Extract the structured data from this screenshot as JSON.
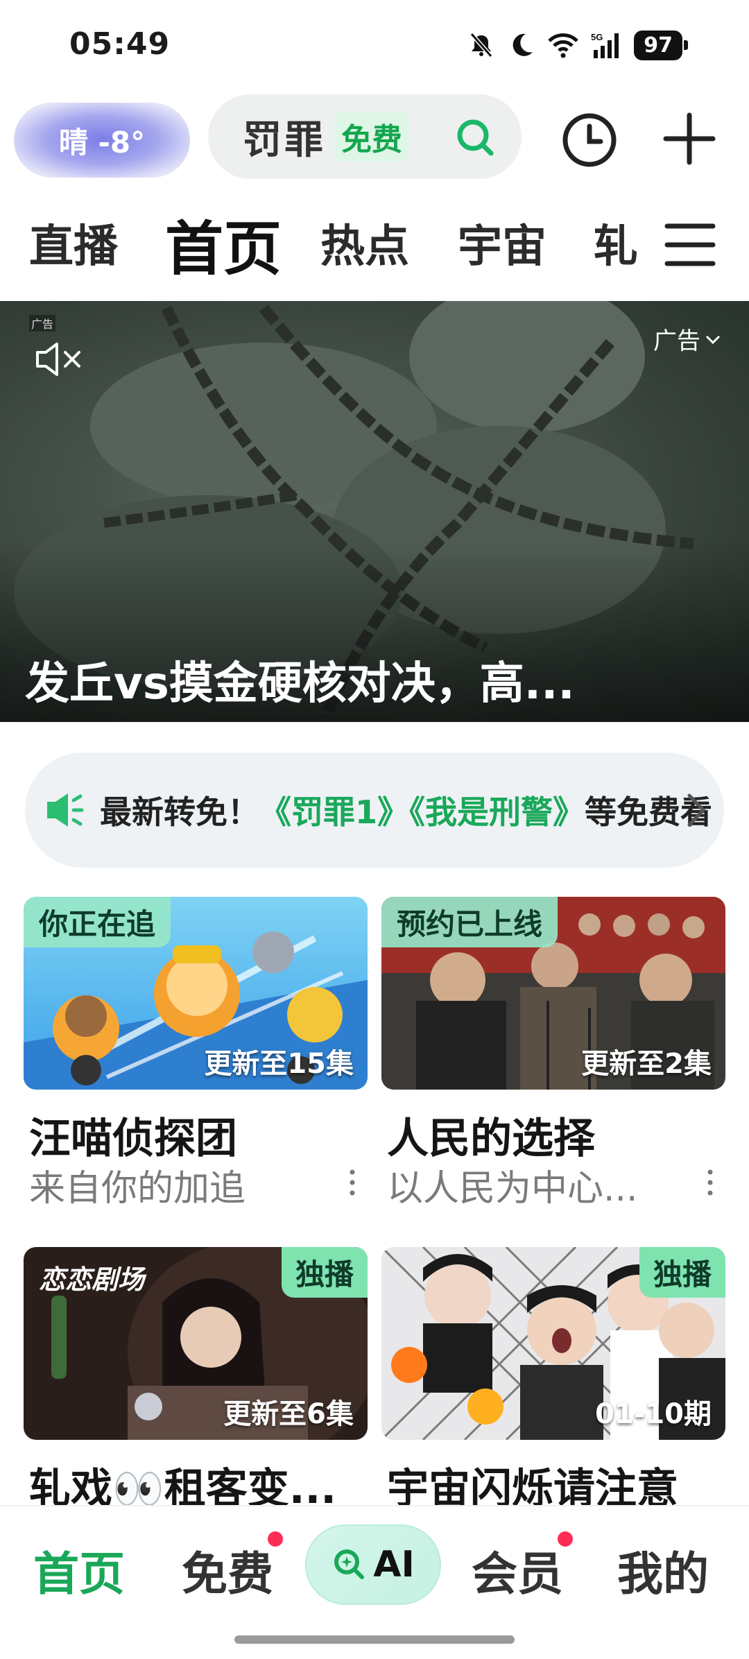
{
  "status_bar": {
    "time": "05:49",
    "battery": "97",
    "network": "5G"
  },
  "top_bar": {
    "weather": "晴 -8°",
    "search_text": "罚罪",
    "search_tag": "免费"
  },
  "channel_tabs": [
    "直播",
    "首页",
    "热点",
    "宇宙",
    "轧"
  ],
  "banner": {
    "ad_small": "广告",
    "ad_label": "广告",
    "title": "发丘vs摸金硬核对决，高..."
  },
  "promo": {
    "prefix": "最新转免！",
    "highlight": "《罚罪1》《我是刑警》",
    "suffix": "等免费看"
  },
  "cards": [
    {
      "tag": "你正在追",
      "episode": "更新至15集",
      "title": "汪喵侦探团",
      "subtitle": "来自你的加追"
    },
    {
      "tag": "预约已上线",
      "episode": "更新至2集",
      "title": "人民的选择",
      "subtitle": "以人民为中心..."
    },
    {
      "tag": "独播",
      "logo_text": "恋恋剧场",
      "episode": "更新至6集",
      "title": "轧戏👀租客变..."
    },
    {
      "tag": "独播",
      "episode": "01-10期",
      "title": "宇宙闪烁请注意"
    }
  ],
  "bottom_nav": {
    "home": "首页",
    "free": "免费",
    "ai": "AI",
    "vip": "会员",
    "mine": "我的"
  },
  "colors": {
    "accent_green": "#1aa858",
    "badge_red": "#ff2d55"
  }
}
